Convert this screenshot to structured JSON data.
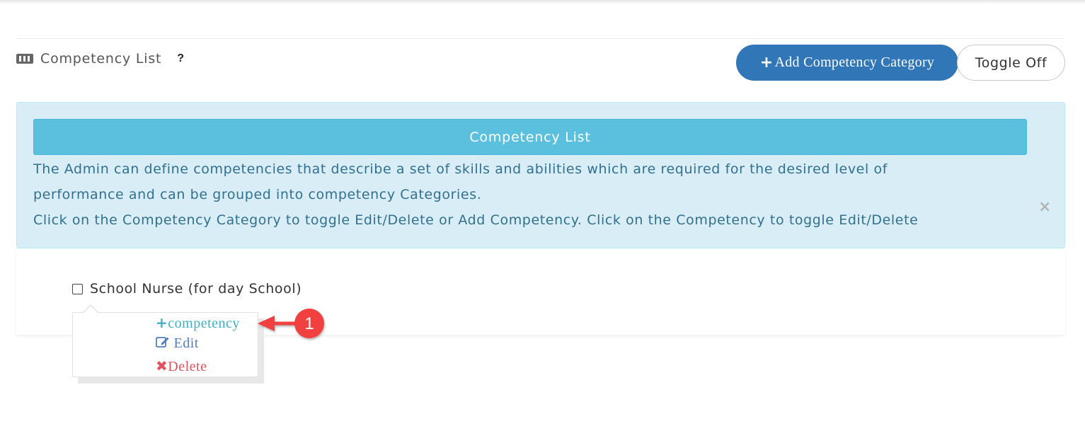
{
  "header": {
    "title": "Competency List",
    "help_label": "?",
    "list_icon": "list-icon",
    "add_category_label": "Add Competency Category",
    "toggle_label": "Toggle Off"
  },
  "alert": {
    "heading": "Competency List",
    "line1": "The Admin can define competencies that describe a set of skills and abilities which are required for the desired level of",
    "line2": "performance and can be grouped into competency Categories.",
    "line3": "Click on the Competency Category to toggle Edit/Delete or Add Competency. Click on the Competency to toggle Edit/Delete",
    "close_label": "×"
  },
  "category": {
    "label": "School Nurse (for day School)",
    "checked": false
  },
  "popover": {
    "add_competency_label": "competency",
    "edit_label": "Edit",
    "delete_label": "Delete"
  },
  "annotation": {
    "step_number": "1",
    "color": "#f04040"
  },
  "colors": {
    "primary": "#3177b8",
    "info_bg": "#d9edf7",
    "info_heading": "#5bc0de",
    "info_text": "#31708f",
    "add_link": "#3db0c8",
    "edit_link": "#4f7fc0",
    "delete_link": "#e0525e"
  }
}
